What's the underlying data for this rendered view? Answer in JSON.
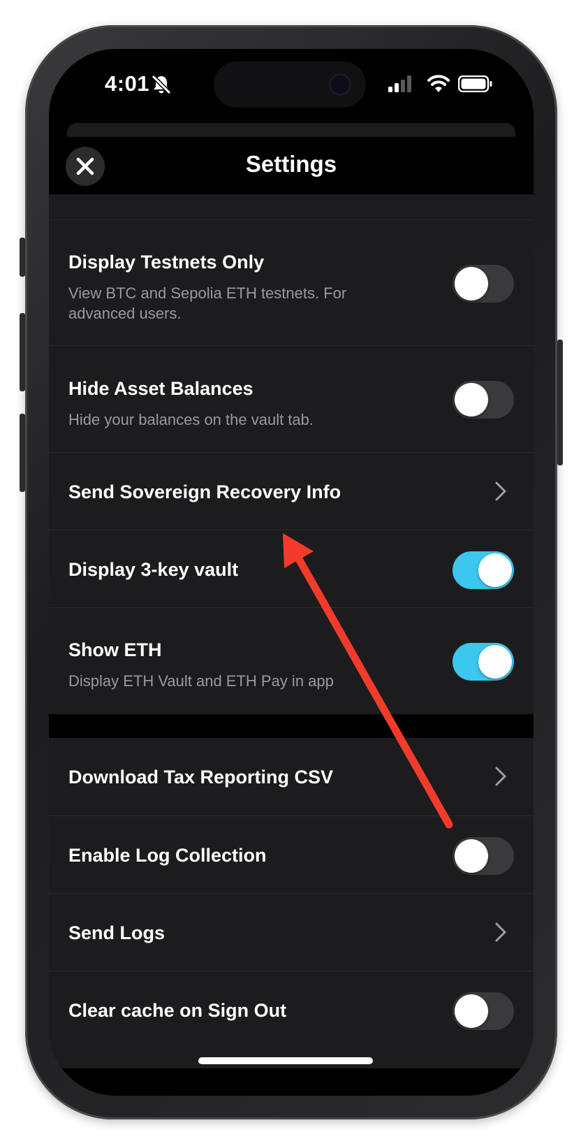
{
  "status_bar": {
    "time": "4:01"
  },
  "header": {
    "title": "Settings"
  },
  "rows": [
    {
      "title": "Display Testnets Only",
      "description": "View BTC and Sepolia ETH testnets. For advanced users.",
      "control": "toggle",
      "on": false
    },
    {
      "title": "Hide Asset Balances",
      "description": "Hide your balances on the vault tab.",
      "control": "toggle",
      "on": false
    },
    {
      "title": "Send Sovereign Recovery Info",
      "control": "chevron"
    },
    {
      "title": "Display 3-key vault",
      "control": "toggle",
      "on": true
    },
    {
      "title": "Show ETH",
      "description": "Display ETH Vault and ETH Pay in app",
      "control": "toggle",
      "on": true
    },
    {
      "title": "Download Tax Reporting CSV",
      "control": "chevron"
    },
    {
      "title": "Enable Log Collection",
      "control": "toggle",
      "on": false
    },
    {
      "title": "Send Logs",
      "control": "chevron"
    },
    {
      "title": "Clear cache on Sign Out",
      "control": "toggle",
      "on": false
    }
  ],
  "colors": {
    "toggle_on": "#3bc7ee",
    "toggle_off": "#3a3a3c",
    "row_bg": "#1c1c1e",
    "annotation_arrow": "#f23b2a"
  },
  "icons": [
    "bell-slash-icon",
    "signal-icon",
    "wifi-icon",
    "battery-icon",
    "close-icon",
    "chevron-right-icon"
  ]
}
